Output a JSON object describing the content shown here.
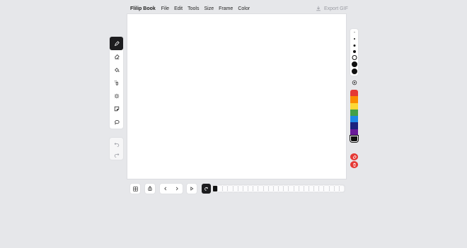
{
  "app": {
    "title": "Flilip Book"
  },
  "menu": [
    "File",
    "Edit",
    "Tools",
    "Size",
    "Frame",
    "Color"
  ],
  "export": {
    "label": "Export GIF",
    "disabled": true
  },
  "tools": [
    {
      "name": "pencil",
      "active": true
    },
    {
      "name": "eraser",
      "active": false
    },
    {
      "name": "fill",
      "active": false
    },
    {
      "name": "spray",
      "active": false
    },
    {
      "name": "sparkle",
      "active": false
    },
    {
      "name": "sticker",
      "active": false
    },
    {
      "name": "lasso",
      "active": false
    }
  ],
  "history": [
    "undo",
    "redo"
  ],
  "brush_sizes": {
    "count": 7,
    "selected_index": 4
  },
  "colors": [
    "#e53935",
    "#fb8c00",
    "#fdd835",
    "#43a047",
    "#1e88e5",
    "#1a237e",
    "#6a1b9a",
    "#111111"
  ],
  "selected_color": "#111111",
  "actions": [
    "clear-frame",
    "delete-frame"
  ],
  "timeline": {
    "frame_count": 26,
    "current_frame": 1
  }
}
